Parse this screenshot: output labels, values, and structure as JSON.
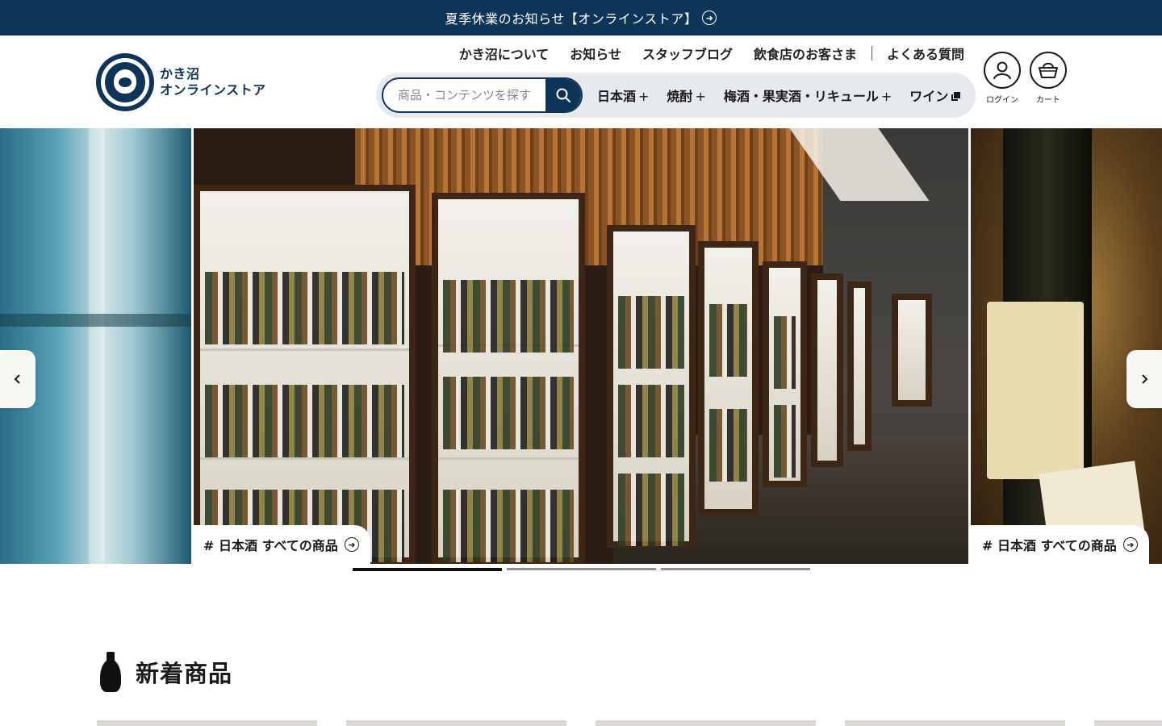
{
  "announcement": {
    "text": "夏季休業のお知らせ【オンラインストア】"
  },
  "logo": {
    "line1": "かき沼",
    "line2": "オンラインストア"
  },
  "util_nav": [
    "かき沼について",
    "お知らせ",
    "スタッフブログ",
    "飲食店のお客さま",
    "よくある質問"
  ],
  "search": {
    "placeholder": "商品・コンテンツを探す"
  },
  "categories": [
    {
      "label": "日本酒",
      "suffix": "+"
    },
    {
      "label": "焼酎",
      "suffix": "+"
    },
    {
      "label": "梅酒・果実酒・リキュール",
      "suffix": "+"
    },
    {
      "label": "ワイン",
      "suffix": ""
    }
  ],
  "account": {
    "login_label": "ログイン",
    "cart_label": "カート"
  },
  "slides": [
    {
      "tag": "# 日本酒 すべての商品"
    },
    {
      "tag": "# 日本酒 すべての商品"
    }
  ],
  "slider": {
    "total": 3,
    "active": 1
  },
  "section": {
    "title": "新着商品"
  },
  "colors": {
    "navy": "#0e3558",
    "pill": "#e6eaee"
  }
}
